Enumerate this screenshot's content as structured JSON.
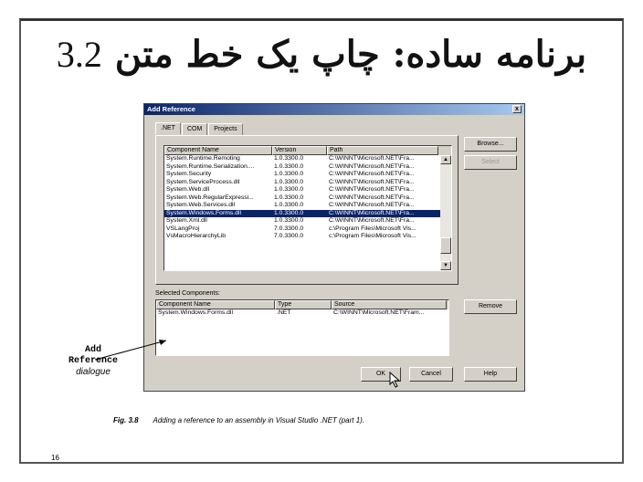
{
  "slide": {
    "title_number": "3.2",
    "title_text": "برنامه ساده: چاپ یک خط متن",
    "page_number": "16"
  },
  "dialog": {
    "title": "Add Reference",
    "close_label": "x",
    "tabs": [
      ".NET",
      "COM",
      "Projects"
    ],
    "components_table": {
      "headers": [
        "Component Name",
        "Version",
        "Path"
      ],
      "rows": [
        [
          "System.Runtime.Remoting",
          "1.0.3300.0",
          "C:\\WINNT\\Microsoft.NET\\Fra..."
        ],
        [
          "System.Runtime.Serialization....",
          "1.0.3300.0",
          "C:\\WINNT\\Microsoft.NET\\Fra..."
        ],
        [
          "System.Security",
          "1.0.3300.0",
          "C:\\WINNT\\Microsoft.NET\\Fra..."
        ],
        [
          "System.ServiceProcess.dll",
          "1.0.3300.0",
          "C:\\WINNT\\Microsoft.NET\\Fra..."
        ],
        [
          "System.Web.dll",
          "1.0.3300.0",
          "C:\\WINNT\\Microsoft.NET\\Fra..."
        ],
        [
          "System.Web.RegularExpressi...",
          "1.0.3300.0",
          "C:\\WINNT\\Microsoft.NET\\Fra..."
        ],
        [
          "System.Web.Services.dll",
          "1.0.3300.0",
          "C:\\WINNT\\Microsoft.NET\\Fra..."
        ],
        [
          "System.Windows.Forms.dll",
          "1.0.3300.0",
          "C:\\WINNT\\Microsoft.NET\\Fra..."
        ],
        [
          "System.Xml.dll",
          "1.0.3300.0",
          "C:\\WINNT\\Microsoft.NET\\Fra..."
        ],
        [
          "VSLangProj",
          "7.0.3300.0",
          "c:\\Program Files\\Microsoft Vis..."
        ],
        [
          "VsMacroHierarchyLib",
          "7.0.3300.0",
          "c:\\Program Files\\Microsoft Vis..."
        ]
      ],
      "selected_index": 7
    },
    "buttons": {
      "browse": "Browse...",
      "select": "Select",
      "remove": "Remove",
      "ok": "OK",
      "cancel": "Cancel",
      "help": "Help"
    },
    "selected_components_label": "Selected Components:",
    "selected_table": {
      "headers": [
        "Component Name",
        "Type",
        "Source"
      ],
      "rows": [
        [
          "System.Windows.Forms.dll",
          ".NET",
          "C:\\WINNT\\Microsoft.NET\\Fram..."
        ]
      ]
    }
  },
  "annotation": {
    "line1": "Add",
    "line2": "Reference",
    "line3": "dialogue"
  },
  "caption": {
    "fig": "Fig. 3.8",
    "text": "Adding a reference to an assembly in Visual Studio .NET (part 1)."
  }
}
